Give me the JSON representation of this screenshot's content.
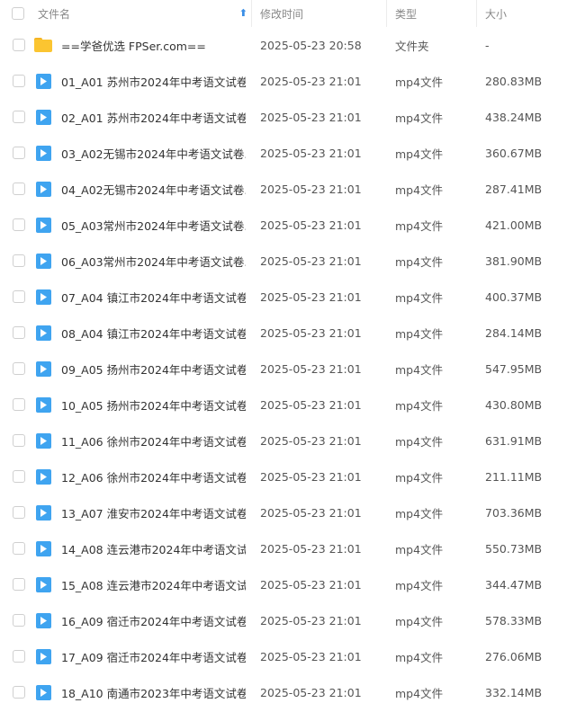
{
  "header": {
    "name_label": "文件名",
    "time_label": "修改时间",
    "type_label": "类型",
    "size_label": "大小",
    "sort_arrow": "⬆"
  },
  "colors": {
    "accent": "#3a8ee6",
    "video_icon": "#3fa4f0",
    "folder_icon": "#fbc531"
  },
  "files": [
    {
      "icon": "folder-icon",
      "name": "==学爸优选 FPSer.com==",
      "time": "2025-05-23 20:58",
      "type": "文件夹",
      "size": "-"
    },
    {
      "icon": "video-icon",
      "name": "01_A01 苏州市2024年中考语文试卷...",
      "time": "2025-05-23 21:01",
      "type": "mp4文件",
      "size": "280.83MB"
    },
    {
      "icon": "video-icon",
      "name": "02_A01 苏州市2024年中考语文试卷...",
      "time": "2025-05-23 21:01",
      "type": "mp4文件",
      "size": "438.24MB"
    },
    {
      "icon": "video-icon",
      "name": "03_A02无锡市2024年中考语文试卷....",
      "time": "2025-05-23 21:01",
      "type": "mp4文件",
      "size": "360.67MB"
    },
    {
      "icon": "video-icon",
      "name": "04_A02无锡市2024年中考语文试卷...",
      "time": "2025-05-23 21:01",
      "type": "mp4文件",
      "size": "287.41MB"
    },
    {
      "icon": "video-icon",
      "name": "05_A03常州市2024年中考语文试卷....",
      "time": "2025-05-23 21:01",
      "type": "mp4文件",
      "size": "421.00MB"
    },
    {
      "icon": "video-icon",
      "name": "06_A03常州市2024年中考语文试卷...",
      "time": "2025-05-23 21:01",
      "type": "mp4文件",
      "size": "381.90MB"
    },
    {
      "icon": "video-icon",
      "name": "07_A04 镇江市2024年中考语文试卷...",
      "time": "2025-05-23 21:01",
      "type": "mp4文件",
      "size": "400.37MB"
    },
    {
      "icon": "video-icon",
      "name": "08_A04 镇江市2024年中考语文试卷...",
      "time": "2025-05-23 21:01",
      "type": "mp4文件",
      "size": "284.14MB"
    },
    {
      "icon": "video-icon",
      "name": "09_A05 扬州市2024年中考语文试卷...",
      "time": "2025-05-23 21:01",
      "type": "mp4文件",
      "size": "547.95MB"
    },
    {
      "icon": "video-icon",
      "name": "10_A05 扬州市2024年中考语文试卷...",
      "time": "2025-05-23 21:01",
      "type": "mp4文件",
      "size": "430.80MB"
    },
    {
      "icon": "video-icon",
      "name": "11_A06 徐州市2024年中考语文试卷...",
      "time": "2025-05-23 21:01",
      "type": "mp4文件",
      "size": "631.91MB"
    },
    {
      "icon": "video-icon",
      "name": "12_A06 徐州市2024年中考语文试卷...",
      "time": "2025-05-23 21:01",
      "type": "mp4文件",
      "size": "211.11MB"
    },
    {
      "icon": "video-icon",
      "name": "13_A07 淮安市2024年中考语文试卷...",
      "time": "2025-05-23 21:01",
      "type": "mp4文件",
      "size": "703.36MB"
    },
    {
      "icon": "video-icon",
      "name": "14_A08 连云港市2024年中考语文试...",
      "time": "2025-05-23 21:01",
      "type": "mp4文件",
      "size": "550.73MB"
    },
    {
      "icon": "video-icon",
      "name": "15_A08 连云港市2024年中考语文试...",
      "time": "2025-05-23 21:01",
      "type": "mp4文件",
      "size": "344.47MB"
    },
    {
      "icon": "video-icon",
      "name": "16_A09 宿迁市2024年中考语文试卷...",
      "time": "2025-05-23 21:01",
      "type": "mp4文件",
      "size": "578.33MB"
    },
    {
      "icon": "video-icon",
      "name": "17_A09 宿迁市2024年中考语文试卷...",
      "time": "2025-05-23 21:01",
      "type": "mp4文件",
      "size": "276.06MB"
    },
    {
      "icon": "video-icon",
      "name": "18_A10 南通市2023年中考语文试卷...",
      "time": "2025-05-23 21:01",
      "type": "mp4文件",
      "size": "332.14MB"
    }
  ]
}
